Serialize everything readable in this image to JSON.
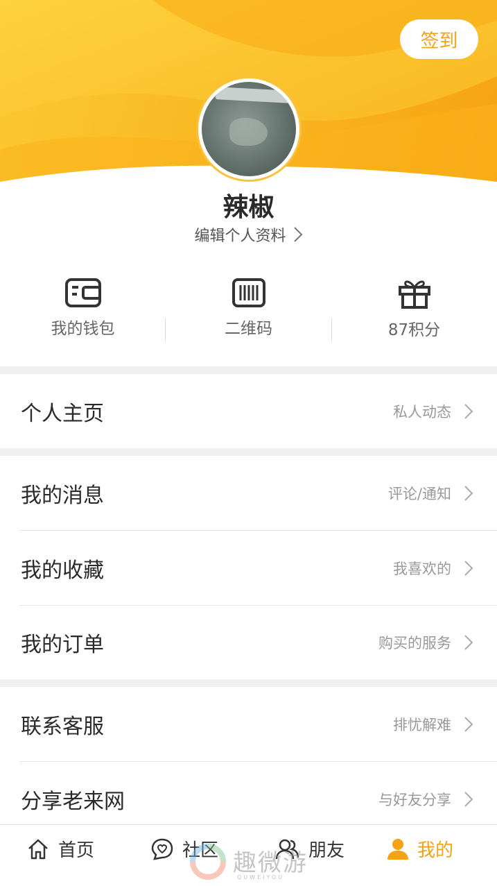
{
  "header": {
    "checkin_label": "签到",
    "username": "辣椒",
    "edit_profile_label": "编辑个人资料",
    "colors": {
      "accent": "#f5a214",
      "header_light": "#fcd33b",
      "header_dark": "#f7a30f"
    }
  },
  "quick_actions": [
    {
      "icon": "wallet-icon",
      "label": "我的钱包"
    },
    {
      "icon": "barcode-icon",
      "label": "二维码"
    },
    {
      "icon": "gift-icon",
      "label": "87积分"
    }
  ],
  "menu": {
    "homepage": {
      "title": "个人主页",
      "hint": "私人动态"
    },
    "messages": {
      "title": "我的消息",
      "hint": "评论/通知"
    },
    "favorites": {
      "title": "我的收藏",
      "hint": "我喜欢的"
    },
    "orders": {
      "title": "我的订单",
      "hint": "购买的服务"
    },
    "support": {
      "title": "联系客服",
      "hint": "排忧解难"
    },
    "share": {
      "title": "分享老来网",
      "hint": "与好友分享"
    }
  },
  "tabbar": [
    {
      "icon": "home-icon",
      "label": "首页",
      "active": false
    },
    {
      "icon": "community-icon",
      "label": "社区",
      "active": false
    },
    {
      "icon": "friends-icon",
      "label": "朋友",
      "active": false
    },
    {
      "icon": "profile-icon",
      "label": "我的",
      "active": true
    }
  ],
  "watermark": {
    "text": "趣微游",
    "sub": "QUWEIYOU"
  }
}
